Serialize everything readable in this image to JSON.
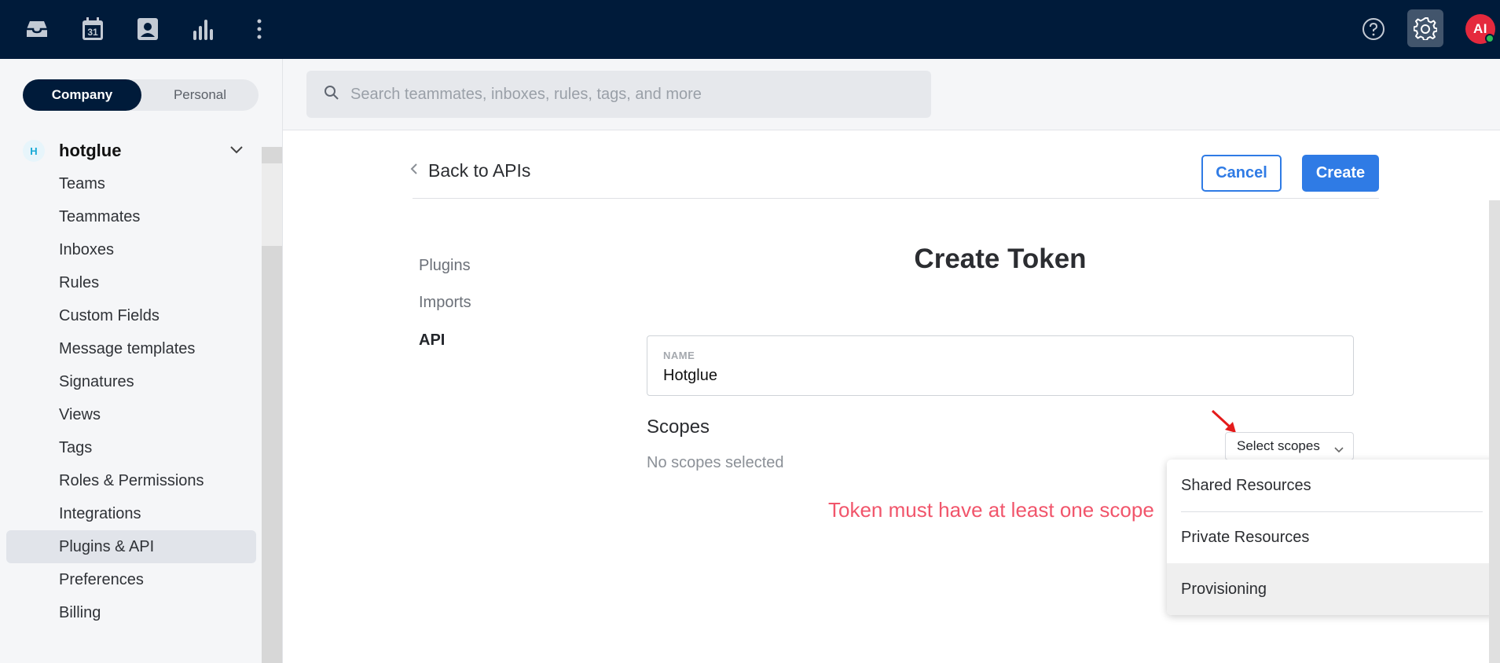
{
  "topbar": {
    "icons": [
      "inbox-icon",
      "calendar-icon",
      "contacts-icon",
      "analytics-icon",
      "more-icon",
      "help-icon",
      "settings-icon"
    ],
    "calendar_day": "31",
    "avatar_initials": "AI",
    "avatar_color": "#e5293d",
    "status_color": "#2dbf58",
    "background_color": "#001b3a"
  },
  "sidebar": {
    "toggle": {
      "company": "Company",
      "personal": "Personal"
    },
    "org": {
      "badge": "H",
      "name": "hotglue"
    },
    "items": [
      {
        "label": "Teams"
      },
      {
        "label": "Teammates"
      },
      {
        "label": "Inboxes"
      },
      {
        "label": "Rules"
      },
      {
        "label": "Custom Fields"
      },
      {
        "label": "Message templates"
      },
      {
        "label": "Signatures"
      },
      {
        "label": "Views"
      },
      {
        "label": "Tags"
      },
      {
        "label": "Roles & Permissions"
      },
      {
        "label": "Integrations"
      },
      {
        "label": "Plugins & API",
        "active": true
      },
      {
        "label": "Preferences"
      },
      {
        "label": "Billing"
      }
    ]
  },
  "search": {
    "placeholder": "Search teammates, inboxes, rules, tags, and more"
  },
  "main": {
    "back_label": "Back to APIs",
    "cancel_label": "Cancel",
    "create_label": "Create",
    "accent_color": "#2f7be5",
    "subnav": [
      {
        "label": "Plugins"
      },
      {
        "label": "Imports"
      },
      {
        "label": "API",
        "active": true
      }
    ],
    "title": "Create Token",
    "name_field": {
      "label": "NAME",
      "value": "Hotglue"
    },
    "scopes": {
      "heading": "Scopes",
      "empty_text": "No scopes selected",
      "select_label": "Select scopes",
      "error": "Token must have at least one scope",
      "error_color": "#f1556b",
      "options": [
        "Shared Resources",
        "Private Resources",
        "Provisioning"
      ],
      "highlighted_option": "Provisioning"
    }
  }
}
